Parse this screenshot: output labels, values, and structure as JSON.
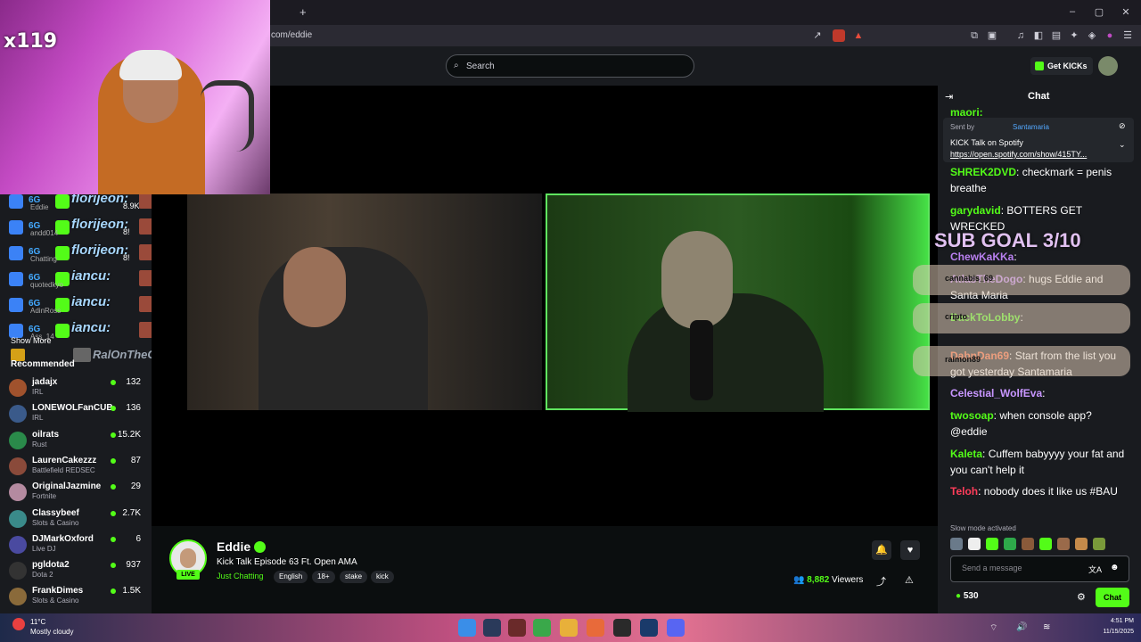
{
  "browser": {
    "url": "com/eddie",
    "new_tab_label": "+",
    "window_controls": [
      "minimize-icon",
      "maximize-icon",
      "close-icon"
    ]
  },
  "header": {
    "search_placeholder": "Search",
    "get_kicks_label": "Get KICKs"
  },
  "overlay": {
    "multiplier": "x119",
    "sub_goal": "SUB GOAL 3/10",
    "alerts": [
      {
        "badge": "6G",
        "name": "florijeon:",
        "sub": "Eddie"
      },
      {
        "badge": "6G",
        "name": "florijeon:",
        "sub": "andd014"
      },
      {
        "badge": "6G",
        "name": "florijeon:",
        "sub": "Chatting"
      },
      {
        "badge": "6G",
        "name": "iancu:",
        "sub": "quotedkyo"
      },
      {
        "badge": "6G",
        "name": "iancu:",
        "sub": "AdinRoss"
      },
      {
        "badge": "6G",
        "name": "iancu:",
        "sub": "Ass_14"
      }
    ],
    "ralonthego": "RalOnTheGo:",
    "counts": [
      "8.9K",
      "8!",
      "8!"
    ],
    "floating_users": [
      "cannabis_69",
      "cripto",
      "raimon89"
    ]
  },
  "sidebar": {
    "show_more": "Show More",
    "recommended_title": "Recommended",
    "channels": [
      {
        "name": "jadajx",
        "category": "IRL",
        "viewers": "132",
        "color": "#a0522d"
      },
      {
        "name": "LONEWOLFanCUB",
        "category": "IRL",
        "viewers": "136",
        "color": "#3a5a8a"
      },
      {
        "name": "oilrats",
        "category": "Rust",
        "viewers": "15.2K",
        "color": "#2a8a4a"
      },
      {
        "name": "LaurenCakezzz",
        "category": "Battlefield REDSEC",
        "viewers": "87",
        "color": "#8a4a3a"
      },
      {
        "name": "OriginalJazmine",
        "category": "Fortnite",
        "viewers": "29",
        "color": "#b48aa0"
      },
      {
        "name": "Classybeef",
        "category": "Slots & Casino",
        "viewers": "2.7K",
        "color": "#3a8a8a"
      },
      {
        "name": "DJMarkOxford",
        "category": "Live DJ",
        "viewers": "6",
        "color": "#4a4aa0"
      },
      {
        "name": "pgldota2",
        "category": "Dota 2",
        "viewers": "937",
        "color": "#333333"
      },
      {
        "name": "FrankDimes",
        "category": "Slots & Casino",
        "viewers": "1.5K",
        "color": "#8a6a3a"
      }
    ]
  },
  "stream": {
    "streamer": "Eddie",
    "title": "Kick Talk Episode 63 Ft. Open AMA",
    "category": "Just Chatting",
    "live_label": "LIVE",
    "tags": [
      "English",
      "18+",
      "stake",
      "kick"
    ],
    "viewers": "8,882",
    "viewers_label": "Viewers"
  },
  "chat": {
    "title": "Chat",
    "pinned": {
      "sent_by_label": "Sent by",
      "sender": "Santamaria",
      "title": "KICK Talk on Spotify",
      "link": "https://open.spotify.com/show/415TY..."
    },
    "messages": [
      {
        "user": "SHREK2DVD",
        "color": "#53fc18",
        "text": "checkmark = penis breathe"
      },
      {
        "user": "garydavid",
        "color": "#53fc18",
        "text": "BOTTERS GET WRECKED"
      },
      {
        "user": "ChewKaKKa",
        "color": "#b980f0",
        "text": ""
      },
      {
        "user": "AtlasTheDogo",
        "color": "#b980f0",
        "text": "hugs Eddie and Santa Maria"
      },
      {
        "user": "BackToLobby",
        "color": "#53fc18",
        "text": ""
      },
      {
        "user": "DabnDan69",
        "color": "#ff6b3d",
        "text": "Start from the list you got yesterday Santamaria"
      },
      {
        "user": "Celestial_WolfEva",
        "color": "#c896ff",
        "text": ""
      },
      {
        "user": "twosoap",
        "color": "#53fc18",
        "text": "when console app? @eddie"
      },
      {
        "user": "Kaleta",
        "color": "#53fc18",
        "text": "Cuffem babyyyy your fat and you can't help it"
      },
      {
        "user": "Teloh",
        "color": "#ff3d5a",
        "text": "nobody does it like us #BAU"
      }
    ],
    "slow_mode": "Slow mode activated",
    "input_placeholder": "Send a message",
    "kicks_balance": "530",
    "send_label": "Chat"
  },
  "taskbar": {
    "temperature": "11°C",
    "weather": "Mostly cloudy",
    "time": "4:51 PM",
    "date": "11/15/2025"
  },
  "colors": {
    "accent": "#53fc18",
    "bg": "#0b0e0f",
    "panel": "#191b1f"
  }
}
